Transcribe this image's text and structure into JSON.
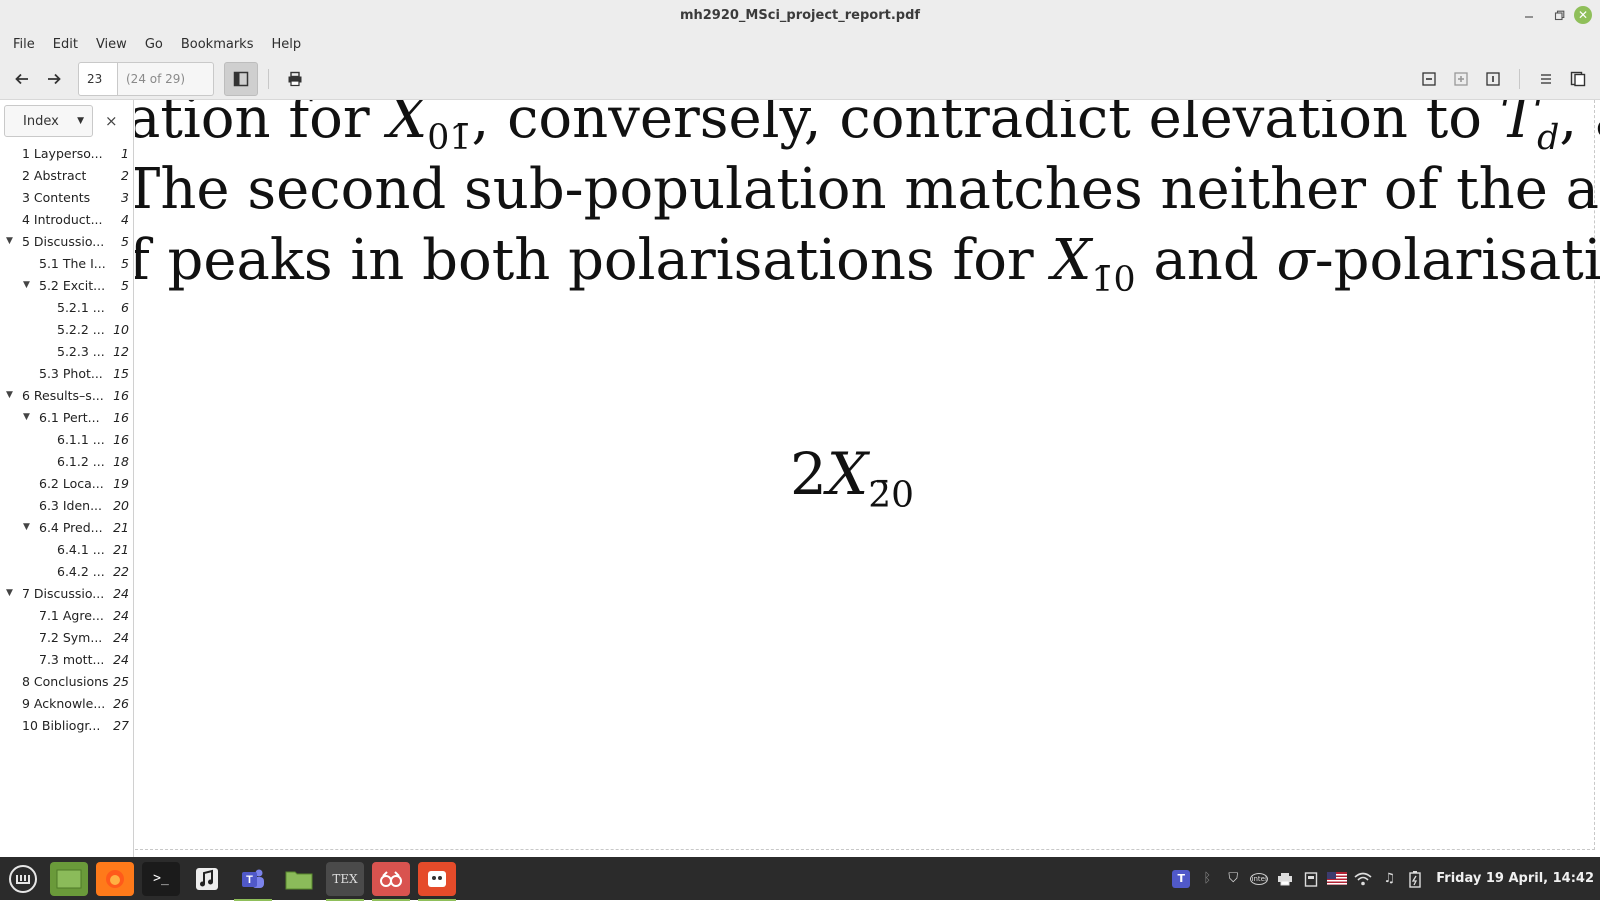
{
  "window": {
    "title": "mh2920_MSci_project_report.pdf"
  },
  "menu": [
    "File",
    "Edit",
    "View",
    "Go",
    "Bookmarks",
    "Help"
  ],
  "toolbar": {
    "page_value": "23",
    "page_total": "(24 of 29)"
  },
  "sidebar": {
    "mode": "Index",
    "close": "×",
    "toc": [
      {
        "label": "1 Layperso...",
        "page": "1",
        "level": 0,
        "expander": ""
      },
      {
        "label": "2 Abstract",
        "page": "2",
        "level": 0,
        "expander": ""
      },
      {
        "label": "3 Contents",
        "page": "3",
        "level": 0,
        "expander": ""
      },
      {
        "label": "4 Introduct...",
        "page": "4",
        "level": 0,
        "expander": ""
      },
      {
        "label": "5 Discussio...",
        "page": "5",
        "level": 0,
        "expander": "▼"
      },
      {
        "label": "5.1 The I...",
        "page": "5",
        "level": 1,
        "expander": ""
      },
      {
        "label": "5.2 Excit...",
        "page": "5",
        "level": 1,
        "expander": "▼"
      },
      {
        "label": "5.2.1 ...",
        "page": "6",
        "level": 2,
        "expander": ""
      },
      {
        "label": "5.2.2 ...",
        "page": "10",
        "level": 2,
        "expander": ""
      },
      {
        "label": "5.2.3 ...",
        "page": "12",
        "level": 2,
        "expander": ""
      },
      {
        "label": "5.3 Phot...",
        "page": "15",
        "level": 1,
        "expander": ""
      },
      {
        "label": "6 Results–s...",
        "page": "16",
        "level": 0,
        "expander": "▼"
      },
      {
        "label": "6.1 Pert...",
        "page": "16",
        "level": 1,
        "expander": "▼"
      },
      {
        "label": "6.1.1 ...",
        "page": "16",
        "level": 2,
        "expander": ""
      },
      {
        "label": "6.1.2 ...",
        "page": "18",
        "level": 2,
        "expander": ""
      },
      {
        "label": "6.2 Loca...",
        "page": "19",
        "level": 1,
        "expander": ""
      },
      {
        "label": "6.3 Iden...",
        "page": "20",
        "level": 1,
        "expander": ""
      },
      {
        "label": "6.4 Pred...",
        "page": "21",
        "level": 1,
        "expander": "▼"
      },
      {
        "label": "6.4.1 ...",
        "page": "21",
        "level": 2,
        "expander": ""
      },
      {
        "label": "6.4.2 ...",
        "page": "22",
        "level": 2,
        "expander": ""
      },
      {
        "label": "7 Discussio...",
        "page": "24",
        "level": 0,
        "expander": "▼"
      },
      {
        "label": "7.1 Agre...",
        "page": "24",
        "level": 1,
        "expander": ""
      },
      {
        "label": "7.2 Sym...",
        "page": "24",
        "level": 1,
        "expander": ""
      },
      {
        "label": "7.3 mott...",
        "page": "24",
        "level": 1,
        "expander": ""
      },
      {
        "label": "8 Conclusions",
        "page": "25",
        "level": 0,
        "expander": ""
      },
      {
        "label": "9 Acknowle...",
        "page": "26",
        "level": 0,
        "expander": ""
      },
      {
        "label": "10 Bibliogr...",
        "page": "27",
        "level": 0,
        "expander": ""
      }
    ]
  },
  "document": {
    "line1": {
      "a": "ation for ",
      "var": "X",
      "sub": "01̄",
      "b": ", conversely, contradict elevation to ",
      "var2": "T",
      "sub2": "d",
      "c": ", as"
    },
    "line2": "The second sub-population matches neither of the analy",
    "line3": {
      "a": "f peaks in both polarisations for ",
      "var": "X",
      "sub": "1̄0",
      "b": " and ",
      "sigma": "σ",
      "c": "-polarisation"
    },
    "equation": {
      "coef": "2",
      "var": "X",
      "sub": "2̄0"
    }
  },
  "taskbar": {
    "apps": [
      "menu-icon",
      "desktop-icon",
      "firefox-icon",
      "terminal-icon",
      "music-icon",
      "teams-icon",
      "files-icon",
      "tex-icon",
      "pdf-reader-icon",
      "gimp-icon"
    ],
    "clock": "Friday 19 April, 14:42"
  }
}
